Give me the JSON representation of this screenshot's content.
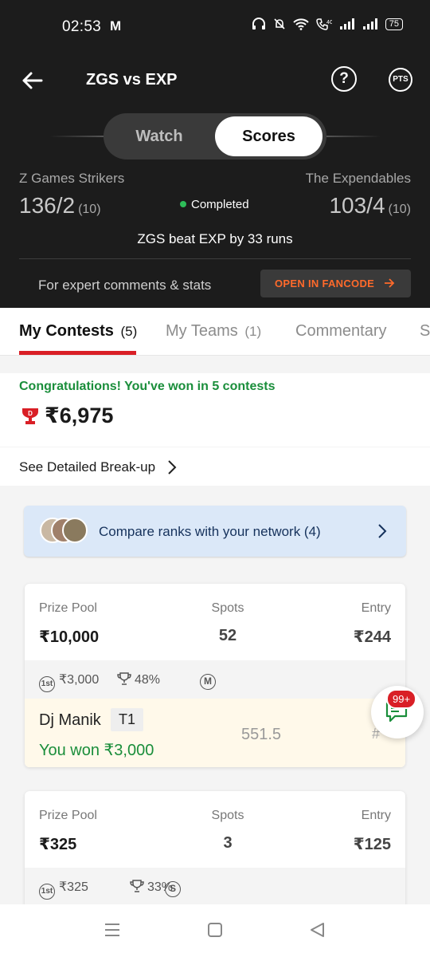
{
  "status_bar": {
    "time": "02:53",
    "mail_icon": "M",
    "battery": "75"
  },
  "nav": {
    "title": "ZGS vs EXP",
    "help_icon": "?",
    "points_label": "PTS"
  },
  "toggle": {
    "watch": "Watch",
    "scores": "Scores",
    "selected": "Scores"
  },
  "match": {
    "team1_name": "Z Games Strikers",
    "team1_score": "136/2",
    "team1_overs": "(10)",
    "team2_name": "The Expendables",
    "team2_score": "103/4",
    "team2_overs": "(10)",
    "status": "Completed",
    "result": "ZGS beat EXP by 33 runs"
  },
  "expert": {
    "text": "For expert comments & stats",
    "button": "OPEN IN FANCODE"
  },
  "tabs": [
    {
      "label": "My Contests",
      "count": "(5)"
    },
    {
      "label": "My Teams",
      "count": "(1)"
    },
    {
      "label": "Commentary",
      "count": ""
    },
    {
      "label": "S",
      "count": ""
    }
  ],
  "winnings": {
    "congrats": "Congratulations! You've won in 5 contests",
    "amount": "₹6,975",
    "breakup": "See Detailed Break-up"
  },
  "compare": {
    "text": "Compare ranks with your network (4)"
  },
  "contests": [
    {
      "prize_pool_label": "Prize Pool",
      "prize_pool": "₹10,000",
      "spots_label": "Spots",
      "spots": "52",
      "entry_label": "Entry",
      "entry": "₹244",
      "first_prize_badge": "1st",
      "first_prize": "₹3,000",
      "win_pct": "48%",
      "type_badge": "M",
      "team": {
        "player": "Dj Manik",
        "team_tag": "T1",
        "won": "You won ₹3,000",
        "points": "551.5",
        "rank": "#"
      }
    },
    {
      "prize_pool_label": "Prize Pool",
      "prize_pool": "₹325",
      "spots_label": "Spots",
      "spots": "3",
      "entry_label": "Entry",
      "entry": "₹125",
      "first_prize_badge": "1st",
      "first_prize": "₹325",
      "win_pct": "33%",
      "type_badge": "S"
    }
  ],
  "chat": {
    "count": "99+"
  },
  "colors": {
    "accent_red": "#d91f26",
    "success_green": "#1a8e3b",
    "fancode_orange": "#ff6a2b",
    "header_dark": "#1c1c1c"
  }
}
